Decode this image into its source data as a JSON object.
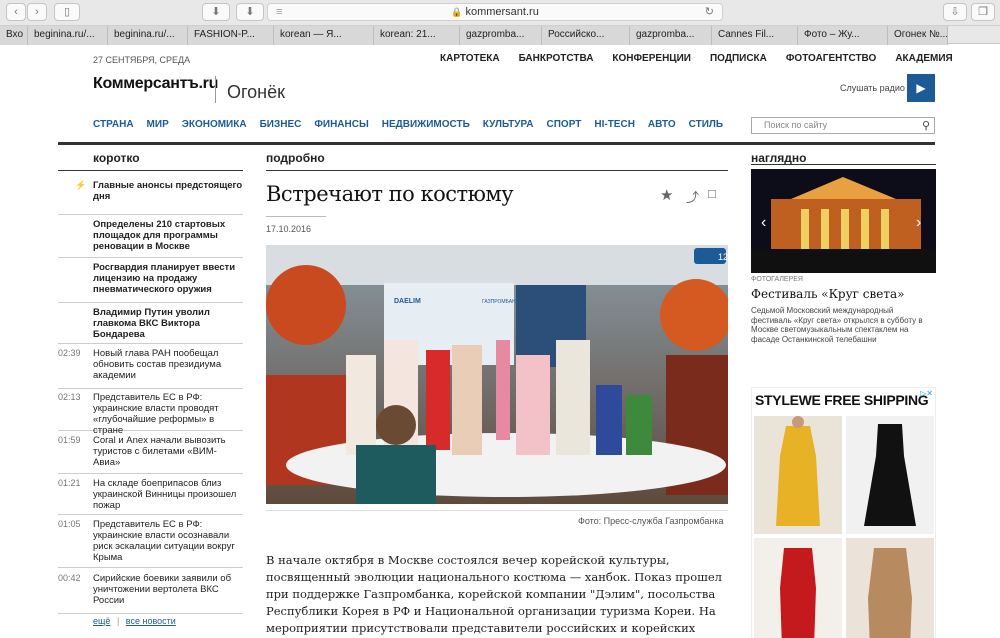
{
  "browser": {
    "url": "kommersant.ru",
    "tabs": [
      "Вхо",
      "beginina.ru/...",
      "beginina.ru/...",
      "FASHION-P...",
      "korean — Я...",
      "korean: 21...",
      "gazpromba...",
      "Российско...",
      "gazpromba...",
      "Cannes Fil...",
      "Фото – Жу...",
      "Огонек №..."
    ]
  },
  "header": {
    "date": "27 СЕНТЯБРЯ, СРЕДА",
    "top_nav": [
      "КАРТОТЕКА",
      "БАНКРОТСТВА",
      "КОНФЕРЕНЦИИ",
      "ПОДПИСКА",
      "ФОТОАГЕНТСТВО",
      "АКАДЕМИЯ"
    ],
    "logo": "Коммерсантъ.ru",
    "sublogo": "Огонёк",
    "radio_label": "Слушать радио",
    "main_nav": [
      "СТРАНА",
      "МИР",
      "ЭКОНОМИКА",
      "БИЗНЕС",
      "ФИНАНСЫ",
      "НЕДВИЖИМОСТЬ",
      "КУЛЬТУРА",
      "СПОРТ",
      "HI-TECH",
      "АВТО",
      "СТИЛЬ"
    ],
    "search_placeholder": "Поиск по сайту"
  },
  "left": {
    "heading": "коротко",
    "items": [
      {
        "time": "",
        "text": "Главные анонсы предстоящего дня",
        "bold": true,
        "icon": "lightning-icon"
      },
      {
        "time": "",
        "text": "Определены 210 стартовых площадок для программы реновации в Москве",
        "bold": true
      },
      {
        "time": "",
        "text": "Росгвардия планирует ввести лицензию на продажу пневматического оружия",
        "bold": true
      },
      {
        "time": "",
        "text": "Владимир Путин уволил главкома ВКС Виктора Бондарева",
        "bold": true
      },
      {
        "time": "02:39",
        "text": "Новый глава РАН пообещал обновить состав президиума академии",
        "bold": false
      },
      {
        "time": "02:13",
        "text": "Представитель ЕС в РФ: украинские власти проводят «глубочайшие реформы» в стране",
        "bold": false
      },
      {
        "time": "01:59",
        "text": "Coral и Anex начали вывозить туристов с билетами «ВИМ-Авиа»",
        "bold": false
      },
      {
        "time": "01:21",
        "text": "На складе боеприпасов близ украинской Винницы произошел пожар",
        "bold": false
      },
      {
        "time": "01:05",
        "text": "Представитель ЕС в РФ: украинские власти осознавали риск эскалации ситуации вокруг Крыма",
        "bold": false
      },
      {
        "time": "00:42",
        "text": "Сирийские боевики заявили об уничтожении вертолета ВКС России",
        "bold": false
      }
    ],
    "more": "ещё",
    "all_news": "все новости"
  },
  "article": {
    "heading": "подробно",
    "title": "Встречают по костюму",
    "date": "17.10.2016",
    "photo_count": "12",
    "photo_banner_left": "DAELIM",
    "photo_banner_right": "ГАЗПРОМБАНК",
    "caption": "Фото: Пресс-служба Газпромбанка",
    "body": "В начале октября в Москве состоялся вечер корейской культуры, посвященный эволюции национального костюма — ханбок. Показ прошел при поддержке Газпромбанка, корейской компании \"Дэлим\", посольства Республики Корея в РФ и Национальной организации туризма Кореи. На мероприятии присутствовали представители российских и корейских деловых кругов,"
  },
  "right": {
    "heading": "наглядно",
    "label": "ФОТОГАЛЕРЕЯ",
    "title": "Фестиваль «Круг света»",
    "desc": "Седьмой Московский международный фестиваль «Круг света» открылся в субботу в Москве светомузыкальным спектаклем на фасаде Останкинской телебашни",
    "ad_headline": "STYLEWE FREE SHIPPING"
  },
  "colors": {
    "link": "#1d5b96",
    "rule": "#333333"
  }
}
